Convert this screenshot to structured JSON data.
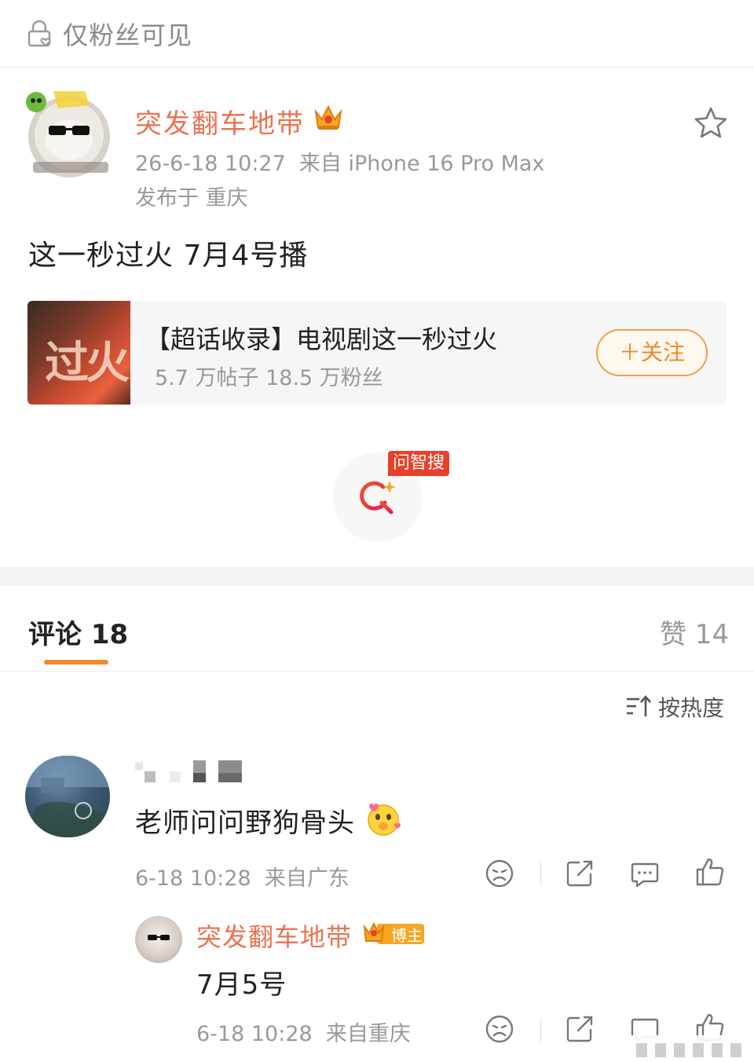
{
  "visibility": {
    "text": "仅粉丝可见",
    "icon": "lock-heart-icon"
  },
  "post": {
    "author": "突发翻车地带",
    "author_badge_icon": "crown-icon",
    "meta": "26-6-18 10:27  来自 iPhone 16 Pro Max",
    "location": "发布于 重庆",
    "text": "这一秒过火 7月4号播",
    "favorite_icon": "star-outline-icon",
    "author_color": "#eb7350"
  },
  "topic_card": {
    "cover_text": "过火",
    "title": "【超话收录】电视剧这一秒过火",
    "stats": "5.7 万帖子 18.5 万粉丝",
    "follow_label": "＋关注"
  },
  "ai_search": {
    "badge": "问智搜",
    "icon": "ai-search-icon"
  },
  "tabs": {
    "comments_label": "评论 18",
    "likes_label": "赞 14",
    "accent_color": "#f08a2a"
  },
  "sort": {
    "label": "按热度",
    "icon": "sort-icon"
  },
  "comments": [
    {
      "text": "老师问问野狗骨头",
      "emoji": "blush-emoji-icon",
      "meta": "6-18 10:28  来自广东",
      "actions": [
        "dislike-icon",
        "share-icon",
        "reply-icon",
        "like-icon"
      ],
      "reply": {
        "username": "突发翻车地带",
        "badge": "博主",
        "text": "7月5号",
        "meta": "6-18 10:28  来自重庆",
        "actions": [
          "dislike-icon",
          "share-icon",
          "reply-icon",
          "like-icon"
        ]
      }
    }
  ]
}
